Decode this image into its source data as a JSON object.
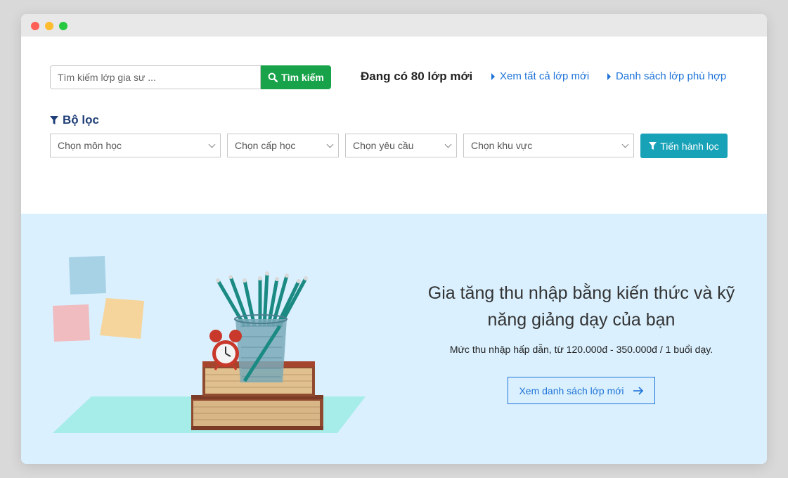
{
  "search": {
    "placeholder": "Tìm kiếm lớp gia sư ...",
    "button_label": "Tìm kiếm"
  },
  "header": {
    "class_count_text": "Đang có 80 lớp mới",
    "link_all_new": "Xem tất cả lớp mới",
    "link_matching": "Danh sách lớp phù hợp"
  },
  "filter": {
    "title": "Bộ lọc",
    "subject_select": "Chọn môn học",
    "level_select": "Chọn cấp học",
    "requirement_select": "Chọn yêu cầu",
    "area_select": "Chọn khu vực",
    "apply_button": "Tiến hành lọc"
  },
  "banner": {
    "headline": "Gia tăng thu nhập bằng kiến thức và kỹ năng giảng dạy của bạn",
    "subtext": "Mức thu nhập hấp dẫn, từ 120.000đ - 350.000đ / 1 buổi dạy.",
    "cta_label": "Xem danh sách lớp mới"
  },
  "colors": {
    "search_button": "#18a34a",
    "filter_button": "#17a2b8",
    "link": "#1e73d8",
    "filter_title": "#1f3e77",
    "banner_bg": "#daf0fe"
  }
}
